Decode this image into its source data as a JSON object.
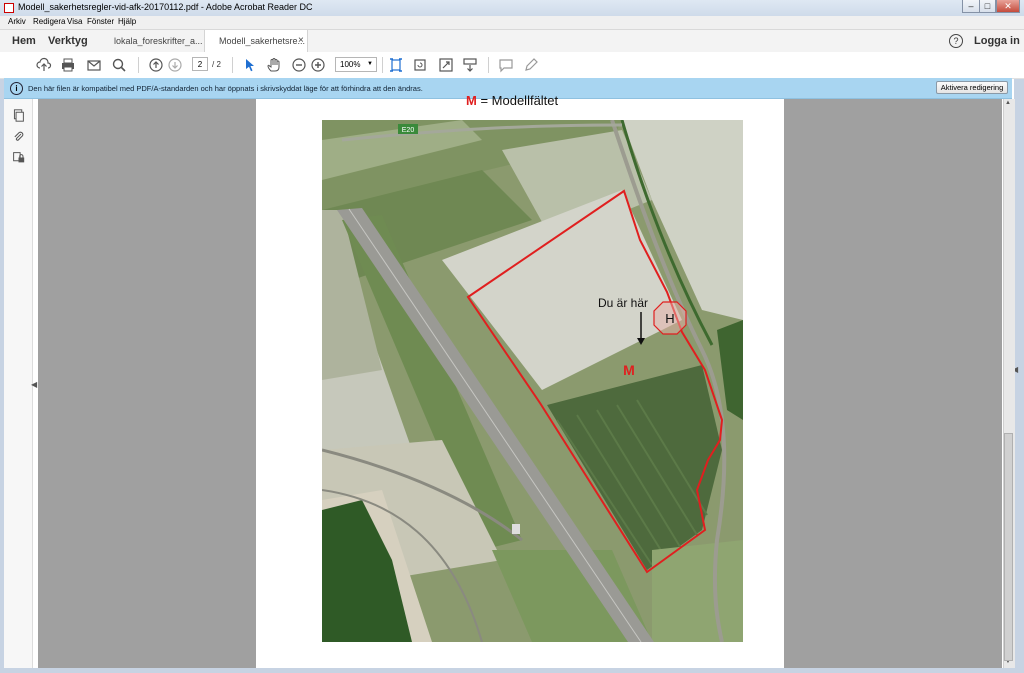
{
  "window": {
    "title": "Modell_sakerhetsregler-vid-afk-20170112.pdf - Adobe Acrobat Reader DC",
    "minimize": "–",
    "maximize": "□",
    "close": "✕"
  },
  "menu": [
    "Arkiv",
    "Redigera",
    "Visa",
    "Fönster",
    "Hjälp"
  ],
  "tabs": {
    "home": "Hem",
    "tools": "Verktyg",
    "docs": [
      {
        "label": "lokala_foreskrifter_a..."
      },
      {
        "label": "Modell_sakerhetsre...",
        "close": "×"
      }
    ],
    "help_icon": "?",
    "login": "Logga in"
  },
  "toolbar": {
    "icons": [
      "upload-icon",
      "print-icon",
      "email-icon",
      "search-icon",
      "page-up-icon",
      "page-down-icon",
      "select-cursor-icon",
      "hand-icon",
      "zoom-out-icon",
      "zoom-in-icon",
      "fit-page-icon",
      "rotate-icon",
      "fullscreen-icon",
      "read-mode-icon",
      "comment-icon",
      "pen-icon"
    ],
    "page_current": "2",
    "page_total": "/ 2",
    "zoom": "100%"
  },
  "infobar": {
    "message": "Den här filen är kompatibel med PDF/A-standarden och har öppnats i skrivskyddat läge för att förhindra att den ändras.",
    "button": "Aktivera redigering"
  },
  "document": {
    "legend_letter": "M",
    "legend_text": " = Modellfältet",
    "map_labels": {
      "you_are_here": "Du är här",
      "heli": "H",
      "field_marker": "M",
      "road": "E20"
    }
  },
  "colors": {
    "accent_red": "#e01f1f",
    "infobar_bg": "#a8d5f1"
  }
}
